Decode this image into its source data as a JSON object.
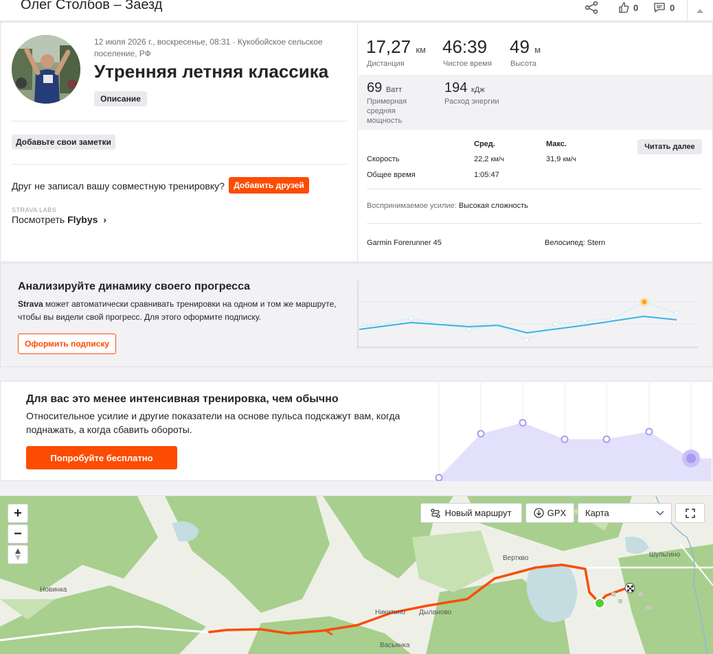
{
  "header": {
    "title": "Олег Столбов – Заезд",
    "likes": "0",
    "comments": "0"
  },
  "activity": {
    "meta": "12 июля 2026 г., воскресенье, 08:31 · Кукобойское сельское поселение, РФ",
    "title": "Утренняя летняя классика",
    "description_button": "Описание",
    "add_notes_button": "Добавьте свои заметки",
    "friend_prompt": "Друг не записал вашу совместную тренировку?",
    "add_friends_button": "Добавить друзей",
    "labs_tag": "STRAVA LABS",
    "flybys_prefix": "Посмотреть ",
    "flybys_bold": "Flybys",
    "flybys_chevron": "›"
  },
  "stats": {
    "distance_value": "17,27",
    "distance_unit": "км",
    "distance_label": "Дистанция",
    "moving_time_value": "46:39",
    "moving_time_label": "Чистое время",
    "elevation_value": "49",
    "elevation_unit": "м",
    "elevation_label": "Высота",
    "power_value": "69",
    "power_unit": "Ватт",
    "power_label_1": "Примерная",
    "power_label_2": "средняя",
    "power_label_3": "мощность",
    "energy_value": "194",
    "energy_unit": "кДж",
    "energy_label": "Расход энергии"
  },
  "details": {
    "col_avg": "Сред.",
    "col_max": "Макс.",
    "read_more_button": "Читать далее",
    "speed_label": "Скорость",
    "speed_avg": "22,2",
    "speed_avg_unit": "км/ч",
    "speed_max": "31,9",
    "speed_max_unit": "км/ч",
    "total_time_label": "Общее время",
    "total_time_value": "1:05:47",
    "perceived_label": "Воспринимаемое усилие:",
    "perceived_value": "Высокая сложность",
    "device": "Garmin Forerunner 45",
    "bike_label": "Велосипед:",
    "bike_value": "Stern"
  },
  "progress_card": {
    "title": "Анализируйте динамику своего прогресса",
    "body_bold": "Strava",
    "body": " может автоматически сравнивать тренировки на одном и том же маршруте, чтобы вы видели свой прогресс. Для этого оформите подписку.",
    "button": "Оформить подписку"
  },
  "effort_card": {
    "title": "Для вас это менее интенсивная тренировка, чем обычно",
    "body": "Относительное усилие и другие показатели на основе пульса подскажут вам, когда поднажать, а когда сбавить обороты.",
    "button": "Попробуйте бесплатно"
  },
  "map": {
    "zoom_in": "+",
    "zoom_out": "−",
    "compass": "⇅",
    "new_route_button": "Новый маршрут",
    "gpx_button": "GPX",
    "map_type_selected": "Карта",
    "places": [
      "Верткво",
      "Шульгино",
      "Новинка",
      "Никитино",
      "Дыланово",
      "Васьянка"
    ]
  },
  "colors": {
    "accent": "#fc4c02",
    "chart_blue": "#38b3e6",
    "effort_purple": "#a79af0"
  }
}
